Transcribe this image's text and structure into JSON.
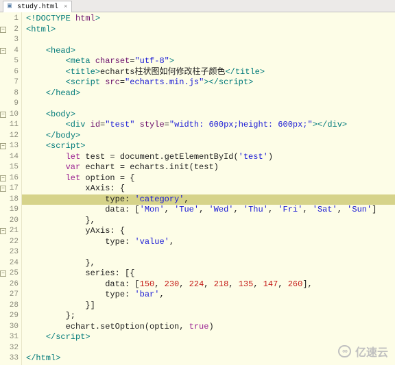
{
  "tab": {
    "filename": "study.html",
    "close": "×"
  },
  "foldable_lines": [
    2,
    4,
    10,
    13,
    16,
    17,
    21,
    25
  ],
  "highlight_line": 18,
  "lines": [
    {
      "n": 1,
      "seg": [
        [
          "tag",
          "<!DOCTYPE"
        ],
        [
          "txt",
          " "
        ],
        [
          "attr",
          "html"
        ],
        [
          "tag",
          ">"
        ]
      ]
    },
    {
      "n": 2,
      "seg": [
        [
          "tag",
          "<html>"
        ]
      ]
    },
    {
      "n": 3,
      "seg": []
    },
    {
      "n": 4,
      "indent": 1,
      "seg": [
        [
          "tag",
          "<head>"
        ]
      ]
    },
    {
      "n": 5,
      "indent": 2,
      "seg": [
        [
          "tag",
          "<meta"
        ],
        [
          "txt",
          " "
        ],
        [
          "attr",
          "charset"
        ],
        [
          "txt",
          "="
        ],
        [
          "str",
          "\"utf-8\""
        ],
        [
          "tag",
          ">"
        ]
      ]
    },
    {
      "n": 6,
      "indent": 2,
      "seg": [
        [
          "tag",
          "<title>"
        ],
        [
          "txt",
          "echarts柱状图如何修改柱子颜色"
        ],
        [
          "tag",
          "</title>"
        ]
      ]
    },
    {
      "n": 7,
      "indent": 2,
      "seg": [
        [
          "tag",
          "<script"
        ],
        [
          "txt",
          " "
        ],
        [
          "attr",
          "src"
        ],
        [
          "txt",
          "="
        ],
        [
          "str",
          "\"echarts.min.js\""
        ],
        [
          "tag",
          "></"
        ],
        [
          "tag",
          "script>"
        ]
      ]
    },
    {
      "n": 8,
      "indent": 1,
      "seg": [
        [
          "tag",
          "</head>"
        ]
      ]
    },
    {
      "n": 9,
      "seg": []
    },
    {
      "n": 10,
      "indent": 1,
      "seg": [
        [
          "tag",
          "<body>"
        ]
      ]
    },
    {
      "n": 11,
      "indent": 2,
      "seg": [
        [
          "tag",
          "<div"
        ],
        [
          "txt",
          " "
        ],
        [
          "attr",
          "id"
        ],
        [
          "txt",
          "="
        ],
        [
          "str",
          "\"test\""
        ],
        [
          "txt",
          " "
        ],
        [
          "attr",
          "style"
        ],
        [
          "txt",
          "="
        ],
        [
          "str",
          "\"width: 600px;height: 600px;\""
        ],
        [
          "tag",
          "></"
        ],
        [
          "tag",
          "div>"
        ]
      ]
    },
    {
      "n": 12,
      "indent": 1,
      "seg": [
        [
          "tag",
          "</body>"
        ]
      ]
    },
    {
      "n": 13,
      "indent": 1,
      "seg": [
        [
          "tag",
          "<script>"
        ]
      ]
    },
    {
      "n": 14,
      "indent": 2,
      "seg": [
        [
          "pur",
          "let"
        ],
        [
          "txt",
          " test = document.getElementById("
        ],
        [
          "str",
          "'test'"
        ],
        [
          "txt",
          ")"
        ]
      ]
    },
    {
      "n": 15,
      "indent": 2,
      "seg": [
        [
          "pur",
          "var"
        ],
        [
          "txt",
          " echart = echarts.init(test)"
        ]
      ]
    },
    {
      "n": 16,
      "indent": 2,
      "seg": [
        [
          "pur",
          "let"
        ],
        [
          "txt",
          " option = {"
        ]
      ]
    },
    {
      "n": 17,
      "indent": 3,
      "seg": [
        [
          "txt",
          "xAxis: {"
        ]
      ]
    },
    {
      "n": 18,
      "indent": 4,
      "seg": [
        [
          "txt",
          "type: "
        ],
        [
          "str",
          "'category'"
        ],
        [
          "txt",
          ","
        ]
      ]
    },
    {
      "n": 19,
      "indent": 4,
      "seg": [
        [
          "txt",
          "data: ["
        ],
        [
          "str",
          "'Mon'"
        ],
        [
          "txt",
          ", "
        ],
        [
          "str",
          "'Tue'"
        ],
        [
          "txt",
          ", "
        ],
        [
          "str",
          "'Wed'"
        ],
        [
          "txt",
          ", "
        ],
        [
          "str",
          "'Thu'"
        ],
        [
          "txt",
          ", "
        ],
        [
          "str",
          "'Fri'"
        ],
        [
          "txt",
          ", "
        ],
        [
          "str",
          "'Sat'"
        ],
        [
          "txt",
          ", "
        ],
        [
          "str",
          "'Sun'"
        ],
        [
          "txt",
          "]"
        ]
      ]
    },
    {
      "n": 20,
      "indent": 3,
      "seg": [
        [
          "txt",
          "},"
        ]
      ]
    },
    {
      "n": 21,
      "indent": 3,
      "seg": [
        [
          "txt",
          "yAxis: {"
        ]
      ]
    },
    {
      "n": 22,
      "indent": 4,
      "seg": [
        [
          "txt",
          "type: "
        ],
        [
          "str",
          "'value'"
        ],
        [
          "txt",
          ","
        ]
      ]
    },
    {
      "n": 23,
      "indent": 0,
      "seg": []
    },
    {
      "n": 24,
      "indent": 3,
      "seg": [
        [
          "txt",
          "},"
        ]
      ]
    },
    {
      "n": 25,
      "indent": 3,
      "seg": [
        [
          "txt",
          "series: [{"
        ]
      ]
    },
    {
      "n": 26,
      "indent": 4,
      "seg": [
        [
          "txt",
          "data: ["
        ],
        [
          "num",
          "150"
        ],
        [
          "txt",
          ", "
        ],
        [
          "num",
          "230"
        ],
        [
          "txt",
          ", "
        ],
        [
          "num",
          "224"
        ],
        [
          "txt",
          ", "
        ],
        [
          "num",
          "218"
        ],
        [
          "txt",
          ", "
        ],
        [
          "num",
          "135"
        ],
        [
          "txt",
          ", "
        ],
        [
          "num",
          "147"
        ],
        [
          "txt",
          ", "
        ],
        [
          "num",
          "260"
        ],
        [
          "txt",
          "],"
        ]
      ]
    },
    {
      "n": 27,
      "indent": 4,
      "seg": [
        [
          "txt",
          "type: "
        ],
        [
          "str",
          "'bar'"
        ],
        [
          "txt",
          ","
        ]
      ]
    },
    {
      "n": 28,
      "indent": 3,
      "seg": [
        [
          "txt",
          "}]"
        ]
      ]
    },
    {
      "n": 29,
      "indent": 2,
      "seg": [
        [
          "txt",
          "};"
        ]
      ]
    },
    {
      "n": 30,
      "indent": 2,
      "seg": [
        [
          "txt",
          "echart.setOption(option, "
        ],
        [
          "pur",
          "true"
        ],
        [
          "txt",
          ")"
        ]
      ]
    },
    {
      "n": 31,
      "indent": 1,
      "seg": [
        [
          "tag",
          "</"
        ],
        [
          "tag",
          "script>"
        ]
      ]
    },
    {
      "n": 32,
      "seg": []
    },
    {
      "n": 33,
      "seg": [
        [
          "tag",
          "</html>"
        ]
      ]
    }
  ],
  "watermark": {
    "icon": "∞",
    "text": "亿速云"
  }
}
